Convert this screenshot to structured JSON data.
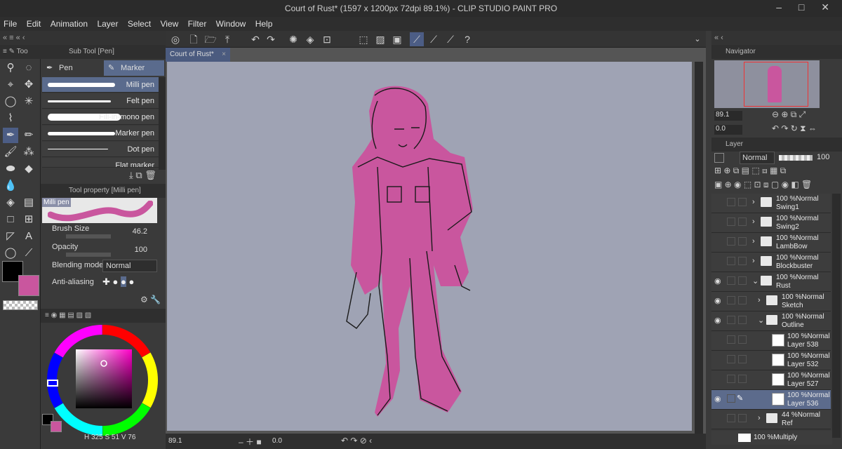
{
  "window": {
    "title": "Court of Rust* (1597 x 1200px 72dpi 89.1%)  - CLIP STUDIO PAINT PRO",
    "controls": "‒ □ ✕"
  },
  "menu": [
    "File",
    "Edit",
    "Animation",
    "Layer",
    "Select",
    "View",
    "Filter",
    "Window",
    "Help"
  ],
  "left": {
    "tool_header": "Too",
    "subtool_header": "Sub Tool [Pen]",
    "tabs": {
      "pen": "Pen",
      "marker": "Marker"
    },
    "brushes": [
      "Milli pen",
      "Felt pen",
      "Fill-in-mono pen",
      "Marker pen",
      "Dot pen",
      "Flat marker"
    ],
    "toolprop_header": "Tool property [Milli pen]",
    "preview_label": "Milli pen",
    "props": {
      "brush_size_label": "Brush Size",
      "brush_size_value": "46.2",
      "opacity_label": "Opacity",
      "opacity_value": "100",
      "blending_label": "Blending mode",
      "blending_value": "Normal",
      "aa_label": "Anti-aliasing"
    },
    "color": {
      "fg": "#000000",
      "bg": "#c9569e",
      "hsv": {
        "h": "325",
        "s": "51",
        "v": "76"
      }
    }
  },
  "canvas": {
    "doc_tab": "Court of Rust*",
    "zoom": "89.1",
    "angle": "0.0",
    "bg": "#9fa3b4",
    "sketch_color": "#c9569e"
  },
  "navigator": {
    "header": "Navigator",
    "zoom": "89.1",
    "angle": "0.0"
  },
  "layers": {
    "header": "Layer",
    "blend": "Normal",
    "opacity": "100",
    "rows": [
      {
        "pct": "100 %",
        "mode": "Normal",
        "name": "Swing1",
        "type": "folder",
        "indent": 0,
        "eye": false
      },
      {
        "pct": "100 %",
        "mode": "Normal",
        "name": "Swing2",
        "type": "folder",
        "indent": 0,
        "eye": false
      },
      {
        "pct": "100 %",
        "mode": "Normal",
        "name": "LambBow",
        "type": "folder",
        "indent": 0,
        "eye": false
      },
      {
        "pct": "100 %",
        "mode": "Normal",
        "name": "Blockbuster",
        "type": "folder",
        "indent": 0,
        "eye": false
      },
      {
        "pct": "100 %",
        "mode": "Normal",
        "name": "Rust",
        "type": "folder-open",
        "indent": 0,
        "eye": true
      },
      {
        "pct": "100 %",
        "mode": "Normal",
        "name": "Sketch",
        "type": "folder",
        "indent": 1,
        "eye": true
      },
      {
        "pct": "100 %",
        "mode": "Normal",
        "name": "Outline",
        "type": "folder-open",
        "indent": 1,
        "eye": true
      },
      {
        "pct": "100 %",
        "mode": "Normal",
        "name": "Layer 538",
        "type": "layer",
        "indent": 2,
        "eye": false
      },
      {
        "pct": "100 %",
        "mode": "Normal",
        "name": "Layer 532",
        "type": "layer",
        "indent": 2,
        "eye": false
      },
      {
        "pct": "100 %",
        "mode": "Normal",
        "name": "Layer 527",
        "type": "layer",
        "indent": 2,
        "eye": false
      },
      {
        "pct": "100 %",
        "mode": "Normal",
        "name": "Layer 536",
        "type": "layer",
        "indent": 2,
        "eye": true,
        "selected": true
      },
      {
        "pct": "44 %",
        "mode": "Normal",
        "name": "Ref",
        "type": "folder",
        "indent": 1,
        "eye": false
      }
    ],
    "bottom": {
      "pct": "100 %",
      "mode": "Multiply"
    }
  }
}
